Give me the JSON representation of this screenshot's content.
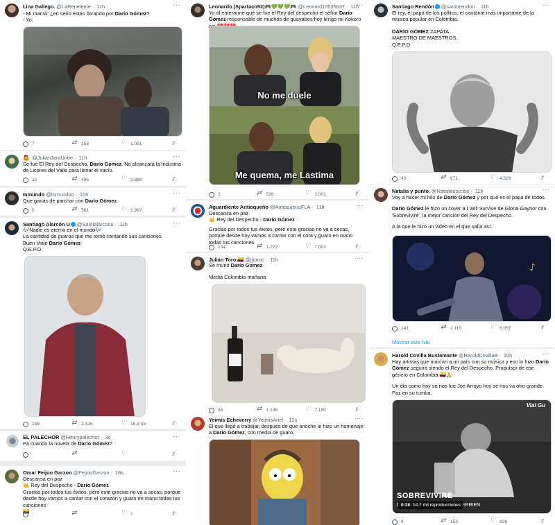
{
  "tweets": {
    "lina": {
      "name": "Lina Gallego.",
      "handle": "@LaRepelente",
      "time": "11h",
      "line1": "- Mi mamá: ¿en serio estás llorando por ",
      "bold1": "Darío Gómez",
      "line1_end": "?",
      "line2": "- Yo:",
      "replies": "7",
      "retweets": "158",
      "likes": "1.091"
    },
    "julian_jara": {
      "handle": "@JulianJaraUribe",
      "time": "11h",
      "text1": "Se fue El Rey del Despecho, ",
      "bold": "Darío Gómez",
      "text2": ". No alcanzará la Industria de Licores del Valle para llenar el vacío.",
      "replies": "25",
      "retweets": "496",
      "likes": "3.888"
    },
    "inmundo": {
      "name": "Inmundo",
      "handle": "@Inmundoo",
      "time": "10h",
      "text1": "Que ganas de parchar con ",
      "bold": "Darío Gómez",
      "text2": ".",
      "replies": "5",
      "retweets": "561",
      "likes": "1.997"
    },
    "santiago_alarcon": {
      "name": "Santiago Alarcón U",
      "handle": "@Santialarconu",
      "time": "11h",
      "l1": "🎶Nadie es eterno en el mundo🎶",
      "l2": "La cantidad de guaros que me tomé cantando sus canciones.",
      "l3a": "Buen Viaje ",
      "l3b": "Darío Gómez",
      "l4": "Q.E.P.D",
      "replies": "158",
      "retweets": "2.426",
      "likes": "16,9 mil"
    },
    "palechor": {
      "name": "EL PALECHOR",
      "handle": "@Henrypalechor",
      "time": "3s",
      "text1": "Pa cuando la novela de ",
      "bold": "Darío Gómez",
      "text2": "?"
    },
    "omar": {
      "name": "Omar Feijoo Garzon",
      "handle": "@FeijooGarzon",
      "time": "18s",
      "l1": "Descansa en paz",
      "l2a": "👑 Rey del Despecho - ",
      "l2b": "Darío Gómez",
      "l3": "Gracias por todos tus éxitos, pero este gracias no va a secas, porque desde hoy vamos a cantar con el corazón  y guaro en mano todas tus canciones",
      "l4": "🇨🇴",
      "likes": "1"
    },
    "leonardo": {
      "name": "Leonardo (Spartaco92)🎮💚💚💚🎮",
      "handle": "@Leonard10535637",
      "time": "11h",
      "text1": "Yo al enterarme que se fue el Rey del despecho el señor ",
      "bold": "Darío Gómez",
      "text2": " responsable de muchos de guayabos hoy tengo mi Kokoro así 💔💔💔",
      "cap1": "No me duele",
      "cap2": "Me quema, me Lastima",
      "replies": "3",
      "retweets": "536",
      "likes": "2.001"
    },
    "aguardiente": {
      "name": "Aguardiente Antioqueño",
      "handle": "@AntioquenoFLA",
      "time": "11h",
      "l1": "Descansa en paz",
      "l2a": "👑 Rey del Despecho - ",
      "l2b": "Darío Gómez",
      "l3": "Gracias por todos tus éxitos, pero este gracias no va a secas, porque desde hoy vamos a cantar con el cora y guaro en mano todas tus canciones.",
      "replies": "134",
      "retweets": "1.272",
      "likes": "7.002"
    },
    "julian_toro": {
      "name": "Julián Toro",
      "flag": "🇨🇴",
      "handle": "@jjtoroc",
      "time": "11h",
      "l1a": "Se murió ",
      "l1b": "Darío Gomez",
      "l2": "Media Colombia mañana",
      "replies": "46",
      "retweets": "1.198",
      "likes": "7.150"
    },
    "yeimis": {
      "name": "Yeimis Echeverry",
      "handle": "@YeimisAriel",
      "time": "12s",
      "t1": "El que llegó a trabajar, después de que anoche le hizo un homenaje a ",
      "b1": "Darío Gómez",
      "t2": ", con media de guaro."
    },
    "santiago_rendon": {
      "name": "Santiago Rendón",
      "handle": "@santorendon",
      "time": "11h",
      "l1": "El rey, el papá de los pollitos, el cantante más importante de la música popular en Colombia.",
      "l2a": "DARÍO GÓMEZ",
      "l2b": " ZAPATA.",
      "l3": "MAESTRO DE MAESTROS.",
      "l4": "Q.E.P.D",
      "replies": "40",
      "retweets": "671",
      "likes": "4.529"
    },
    "natalia": {
      "name": "Natalia y punto.",
      "handle": "@Nataliaescribe",
      "time": "11h",
      "l1a": "Voy a hacer mi hilo de ",
      "l1b": "Darío Gómez",
      "l1c": " y por qué es el papá de todos.",
      "l2a": "Darío Gómez",
      "l2b": " le hizo un cover a I Will Survive de Gloria Gaynor con 'Sobreviviré', la mejor canción del Rey del Despecho.",
      "l3": "A la que le hizo un video en el que salía así:",
      "replies": "141",
      "retweets": "2.110",
      "likes": "6.057",
      "show_thread": "Mostrar este hilo"
    },
    "harold": {
      "name": "Harold Covilla Bustamante",
      "handle": "@HaroldCovillaB",
      "time": "10h",
      "t1": "Hay artistas que marcan a un país con su música y eso lo hizo ",
      "b1": "Darío Gómez",
      "t2": " seguirá siendo el Rey del Despecho. Propulsor de ese género en Colombia 🇨🇴🙏",
      "l2": "Un día como hoy se nos fue Joe Arroyo hoy se nos va otro grande. Paz en su tumba.",
      "video_title": "SOBREVIVIRÉ",
      "video_sub": "DINO FERKARIS FREDDIE PERRIEN",
      "watermark": "Vial Gu",
      "time_badge": "0:38",
      "views": "14,7 mil reproducciones",
      "replies": "4",
      "retweets": "153",
      "likes": "626"
    }
  },
  "colors": {
    "link": "#1d9bf0",
    "muted": "#536471",
    "text": "#0f1419"
  }
}
